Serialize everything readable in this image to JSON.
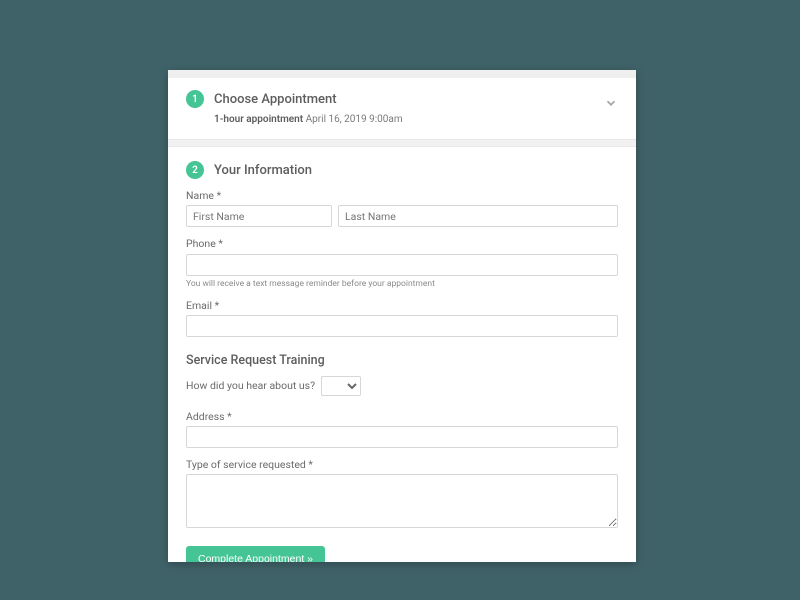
{
  "step1": {
    "number": "1",
    "title": "Choose Appointment",
    "summary_type": "1-hour appointment",
    "summary_date": "April 16, 2019 9:00am"
  },
  "step2": {
    "number": "2",
    "title": "Your Information",
    "name_label": "Name *",
    "first_name_placeholder": "First Name",
    "last_name_placeholder": "Last Name",
    "phone_label": "Phone *",
    "phone_help": "You will receive a text message reminder before your appointment",
    "email_label": "Email *",
    "service_section": "Service Request Training",
    "hear_label": "How did you hear about us?",
    "address_label": "Address *",
    "service_type_label": "Type of service requested *"
  },
  "submit_label": "Complete Appointment »"
}
